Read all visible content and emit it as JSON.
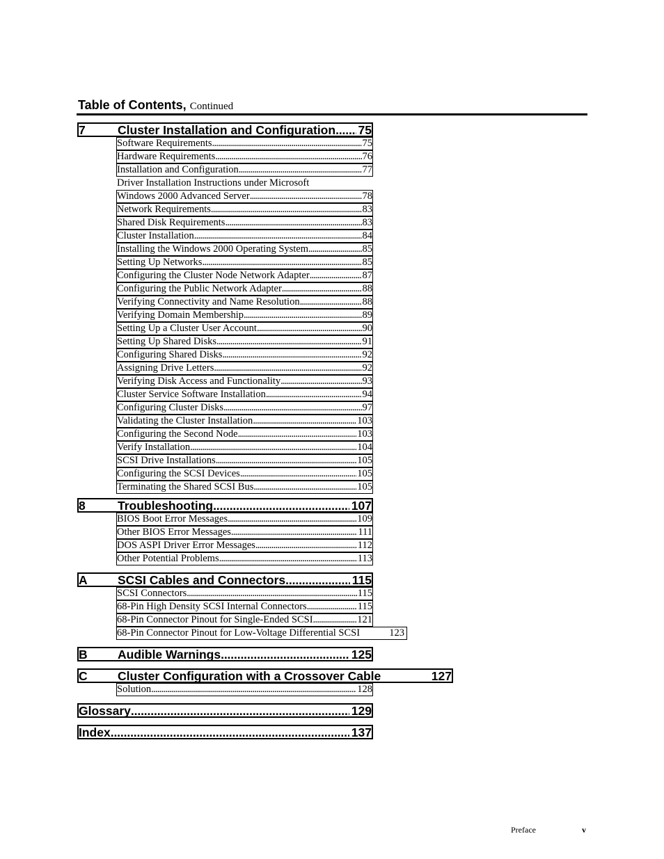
{
  "header": {
    "title": "Table of Contents,",
    "continued": "Continued"
  },
  "chapters": [
    {
      "number": "7",
      "title": "Cluster Installation and Configuration",
      "page": "75",
      "sections": [
        {
          "title": "Software Requirements",
          "page": "75"
        },
        {
          "title": "Hardware Requirements",
          "page": "76"
        },
        {
          "title": "Installation and Configuration",
          "page": "77"
        },
        {
          "title": "Driver Installation Instructions under Microsoft",
          "page": ""
        },
        {
          "title": "Windows 2000 Advanced Server",
          "page": "78"
        },
        {
          "title": "Network Requirements",
          "page": "83"
        },
        {
          "title": "Shared Disk Requirements",
          "page": "83"
        },
        {
          "title": "Cluster Installation",
          "page": "84"
        },
        {
          "title": "Installing the Windows 2000 Operating System",
          "page": "85"
        },
        {
          "title": "Setting Up Networks",
          "page": "85"
        },
        {
          "title": "Configuring the Cluster Node Network Adapter",
          "page": "87"
        },
        {
          "title": "Configuring the Public Network Adapter",
          "page": "88"
        },
        {
          "title": "Verifying Connectivity and Name Resolution",
          "page": "88"
        },
        {
          "title": "Verifying Domain Membership",
          "page": "89"
        },
        {
          "title": "Setting Up a Cluster User Account",
          "page": "90"
        },
        {
          "title": "Setting Up Shared Disks",
          "page": "91"
        },
        {
          "title": "Configuring Shared Disks",
          "page": "92"
        },
        {
          "title": "Assigning Drive Letters",
          "page": "92"
        },
        {
          "title": "Verifying Disk Access and Functionality",
          "page": "93"
        },
        {
          "title": "Cluster Service Software Installation",
          "page": "94"
        },
        {
          "title": "Configuring Cluster Disks",
          "page": "97"
        },
        {
          "title": "Validating the Cluster Installation",
          "page": "103"
        },
        {
          "title": "Configuring the Second Node",
          "page": "103"
        },
        {
          "title": "Verify Installation",
          "page": "104"
        },
        {
          "title": "SCSI Drive Installations",
          "page": "105"
        },
        {
          "title": "Configuring the SCSI Devices",
          "page": "105"
        },
        {
          "title": "Terminating the Shared SCSI Bus",
          "page": "105"
        }
      ]
    },
    {
      "number": "8",
      "title": "Troubleshooting",
      "page": "107",
      "sections": [
        {
          "title": "BIOS Boot Error Messages",
          "page": "109"
        },
        {
          "title": "Other BIOS Error Messages",
          "page": "111"
        },
        {
          "title": "DOS ASPI Driver Error Messages",
          "page": "112"
        },
        {
          "title": "Other Potential Problems",
          "page": "113"
        }
      ]
    },
    {
      "number": "A",
      "title": "SCSI Cables and Connectors",
      "page": "115",
      "sections": [
        {
          "title": "SCSI Connectors",
          "page": "115"
        },
        {
          "title": "68-Pin High Density SCSI Internal Connectors",
          "page": "115"
        },
        {
          "title": "68-Pin Connector Pinout for Single-Ended SCSI",
          "page": "121"
        },
        {
          "title": "68-Pin Connector Pinout for Low-Voltage Differential SCSI",
          "page": "123"
        }
      ]
    },
    {
      "number": "B",
      "title": "Audible Warnings",
      "page": "125",
      "sections": []
    },
    {
      "number": "C",
      "title": "Cluster Configuration with a Crossover Cable",
      "page": "127",
      "sections": [
        {
          "title": "Solution",
          "page": "128"
        }
      ]
    }
  ],
  "glossary": {
    "title": "Glossary",
    "page": "129"
  },
  "index": {
    "title": "Index",
    "page": "137"
  },
  "footer": {
    "label": "Preface",
    "page": "v"
  }
}
